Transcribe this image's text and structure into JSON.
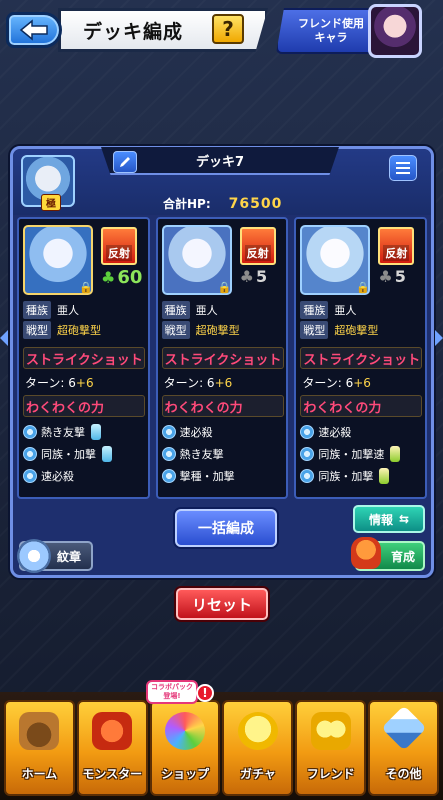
{
  "header": {
    "title": "デッキ編成",
    "help_label": "?",
    "friend_button_line1": "フレンド使用",
    "friend_button_line2": "キャラ"
  },
  "deck": {
    "name": "デッキ7",
    "leader_badge": "極",
    "hp_label": "合計HP:",
    "hp_value": "76500"
  },
  "monsters": [
    {
      "reflect": "反射",
      "luck": "60",
      "luck_max": true,
      "race_label": "種族",
      "race": "亜人",
      "type_label": "戦型",
      "type": "超砲撃型",
      "strike_shot": "ストライクショット",
      "turn_label": "ターン: 6",
      "turn_plus": "+6",
      "ability": "わくわくの力",
      "abilities": [
        "熱き友撃",
        "同族・加撃",
        "速必殺"
      ]
    },
    {
      "reflect": "反射",
      "luck": "5",
      "luck_max": false,
      "race_label": "種族",
      "race": "亜人",
      "type_label": "戦型",
      "type": "超砲撃型",
      "strike_shot": "ストライクショット",
      "turn_label": "ターン: 6",
      "turn_plus": "+6",
      "ability": "わくわくの力",
      "abilities": [
        "速必殺",
        "熱き友撃",
        "撃種・加撃"
      ]
    },
    {
      "reflect": "反射",
      "luck": "5",
      "luck_max": false,
      "race_label": "種族",
      "race": "亜人",
      "type_label": "戦型",
      "type": "超砲撃型",
      "strike_shot": "ストライクショット",
      "turn_label": "ターン: 6",
      "turn_plus": "+6",
      "ability": "わくわくの力",
      "abilities": [
        "速必殺",
        "同族・加撃速",
        "同族・加撃"
      ]
    }
  ],
  "buttons": {
    "bulk_edit": "一括編成",
    "info": "情報",
    "emblem": "紋章",
    "grow": "育成",
    "reset": "リセット"
  },
  "nav": {
    "items": [
      "ホーム",
      "モンスター",
      "ショップ",
      "ガチャ",
      "フレンド",
      "その他"
    ],
    "collab_badge_line1": "コラボパック",
    "collab_badge_line2": "登場!",
    "alert": "!"
  }
}
